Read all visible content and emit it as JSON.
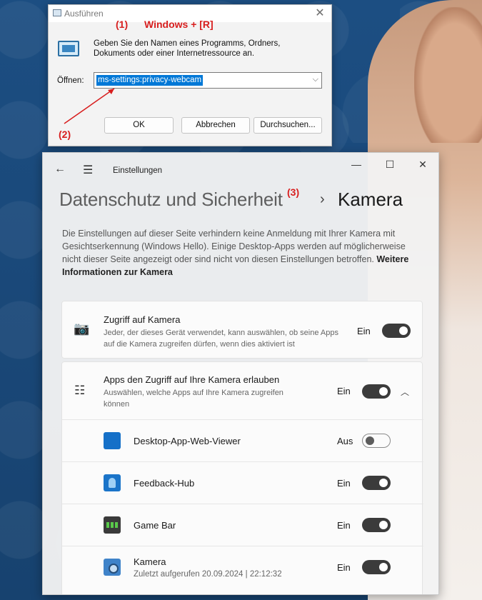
{
  "run_dialog": {
    "title": "Ausführen",
    "description": "Geben Sie den Namen eines Programms, Ordners, Dokuments oder einer Internetressource an.",
    "open_label": "Öffnen:",
    "command_value": "ms-settings:privacy-webcam",
    "buttons": {
      "ok": "OK",
      "cancel": "Abbrechen",
      "browse": "Durchsuchen..."
    }
  },
  "annotations": {
    "step1": "(1)",
    "shortcut": "Windows + [R]",
    "step2": "(2)",
    "step3": "(3)"
  },
  "settings": {
    "app_title": "Einstellungen",
    "breadcrumb_parent": "Datenschutz und Sicherheit",
    "breadcrumb_current": "Kamera",
    "intro_text": "Die Einstellungen auf dieser Seite verhindern keine Anmeldung mit Ihrer Kamera mit Gesichtserkennung (Windows Hello). Einige Desktop-Apps werden auf möglicherweise nicht dieser Seite angezeigt oder sind nicht von diesen Einstellungen betroffen.",
    "intro_link": "Weitere Informationen zur Kamera",
    "camera_access": {
      "title": "Zugriff auf Kamera",
      "subtitle": "Jeder, der dieses Gerät verwendet, kann auswählen, ob seine Apps auf die Kamera zugreifen dürfen, wenn dies aktiviert ist",
      "state": "Ein",
      "on": true
    },
    "app_access": {
      "title": "Apps den Zugriff auf Ihre Kamera erlauben",
      "subtitle": "Auswählen, welche Apps auf Ihre Kamera zugreifen können",
      "state": "Ein",
      "on": true
    },
    "apps": [
      {
        "name": "Desktop-App-Web-Viewer",
        "state": "Aus",
        "on": false,
        "icon": "web-viewer-icon"
      },
      {
        "name": "Feedback-Hub",
        "state": "Ein",
        "on": true,
        "icon": "feedback-hub-icon"
      },
      {
        "name": "Game Bar",
        "state": "Ein",
        "on": true,
        "icon": "game-bar-icon"
      },
      {
        "name": "Kamera",
        "state": "Ein",
        "on": true,
        "icon": "camera-app-icon",
        "last_used": "Zuletzt aufgerufen 20.09.2024  |  22:12:32"
      }
    ]
  },
  "colors": {
    "annotation": "#d81e1e",
    "selection": "#0078d7",
    "toggle_on": "#3b3b3b"
  }
}
